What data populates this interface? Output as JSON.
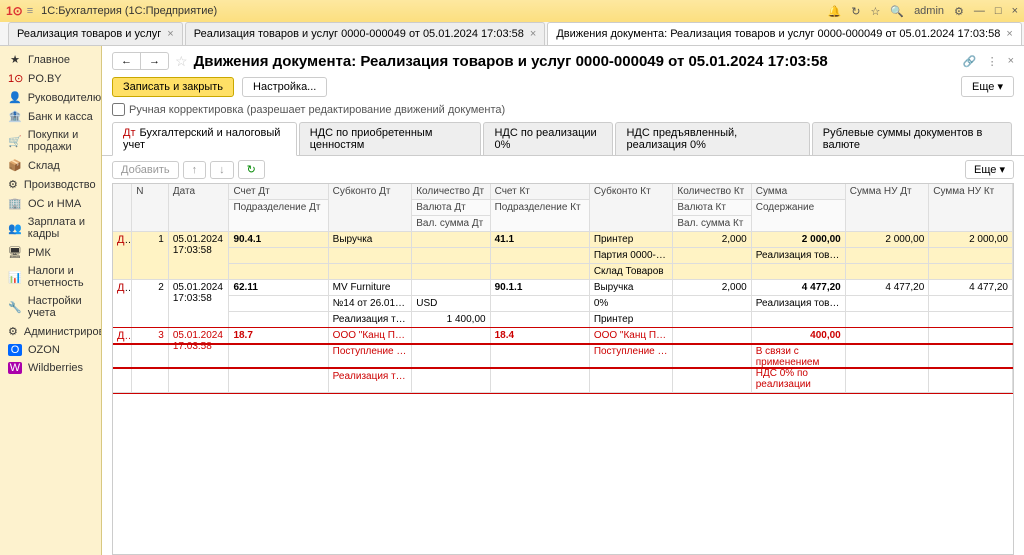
{
  "titlebar": {
    "app": "1С:Бухгалтерия",
    "mode": "(1С:Предприятие)",
    "user": "admin"
  },
  "tabs": [
    {
      "label": "Реализация товаров и услуг"
    },
    {
      "label": "Реализация товаров и услуг 0000-000049 от 05.01.2024 17:03:58"
    },
    {
      "label": "Движения документа: Реализация товаров и услуг 0000-000049 от 05.01.2024 17:03:58"
    }
  ],
  "sidebar": [
    "Главное",
    "PO.BY",
    "Руководителю",
    "Банк и касса",
    "Покупки и продажи",
    "Склад",
    "Производство",
    "ОС и НМА",
    "Зарплата и кадры",
    "РМК",
    "Налоги и отчетность",
    "Настройки учета",
    "Администрирование",
    "OZON",
    "Wildberries"
  ],
  "doc_title": "Движения документа: Реализация товаров и услуг 0000-000049 от 05.01.2024 17:03:58",
  "buttons": {
    "save_close": "Записать и закрыть",
    "settings": "Настройка...",
    "more": "Еще"
  },
  "manual_edit": "Ручная корректировка (разрешает редактирование движений документа)",
  "inner_tabs": [
    "Бухгалтерский и налоговый учет",
    "НДС по приобретенным ценностям",
    "НДС по реализации 0%",
    "НДС предъявленный, реализация 0%",
    "Рублевые суммы документов в валюте"
  ],
  "grid_toolbar": {
    "add": "Добавить",
    "more": "Еще"
  },
  "headers": {
    "n": "N",
    "date": "Дата",
    "dt": "Счет Дт",
    "dt_sub1": "Подразделение Дт",
    "subk_dt": "Субконто Дт",
    "qty_dt": "Количество Дт",
    "cur_dt": "Валюта Дт",
    "valsum_dt": "Вал. сумма Дт",
    "kt": "Счет Кт",
    "kt_sub1": "Подразделение Кт",
    "subk_kt": "Субконто Кт",
    "qty_kt": "Количество Кт",
    "cur_kt": "Валюта Кт",
    "valsum_kt": "Вал. сумма Кт",
    "sum": "Сумма",
    "content": "Содержание",
    "sum_nu_dt": "Сумма НУ Дт",
    "sum_nu_kt": "Сумма НУ Кт"
  },
  "rows": [
    {
      "n": "1",
      "date": "05.01.2024 17:03:58",
      "dt": "90.4.1",
      "subk_dt": "Выручка",
      "qty_dt": "",
      "kt": "41.1",
      "subk_kt1": "Принтер",
      "subk_kt2": "Партия 0000-0005...",
      "subk_kt3": "Склад Товаров",
      "qty_kt": "2,000",
      "sum": "2 000,00",
      "content": "Реализация товаров",
      "nu_dt": "2 000,00",
      "nu_kt": "2 000,00"
    },
    {
      "n": "2",
      "date": "05.01.2024 17:03:58",
      "dt": "62.11",
      "subk_dt1": "MV Furniture",
      "subk_dt2": "№14 от 26.01.2023",
      "subk_dt3": "Реализация товар...",
      "cur_dt": "USD",
      "valsum_dt": "1 400,00",
      "kt": "90.1.1",
      "subk_kt1": "Выручка",
      "subk_kt2": "0%",
      "subk_kt3": "Принтер",
      "qty_kt": "2,000",
      "sum": "4 477,20",
      "content": "Реализация товаров",
      "nu_dt": "4 477,20",
      "nu_kt": "4 477,20"
    },
    {
      "n": "3",
      "date": "05.01.2024 17:03:58",
      "dt": "18.7",
      "subk_dt1": "ООО \"Канц Плюс\"",
      "subk_dt2": "Поступление това...",
      "subk_dt3": "Реализация товар...",
      "kt": "18.4",
      "subk_kt1": "ООО \"Канц Плюс\"",
      "subk_kt2": "Поступление това...",
      "sum": "400,00",
      "content": "В связи с применением НДС 0% по реализации",
      "nu_dt": "",
      "nu_kt": ""
    }
  ]
}
